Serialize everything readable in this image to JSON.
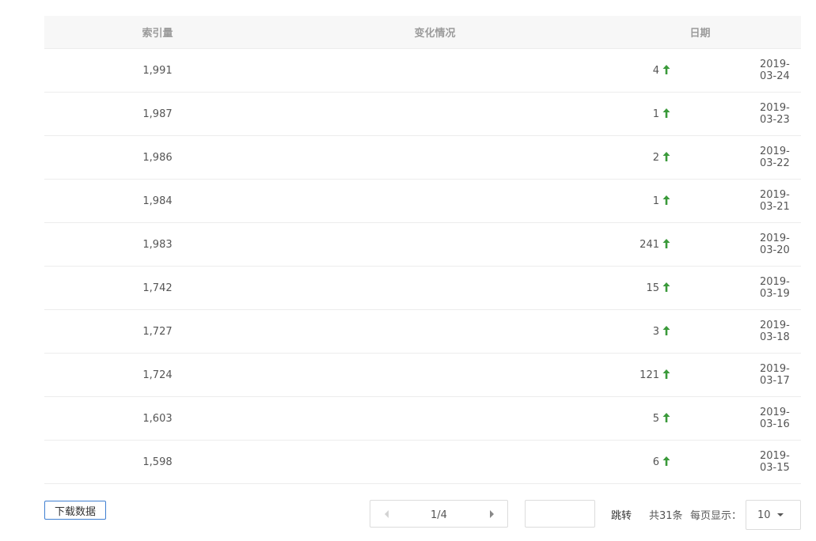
{
  "table": {
    "headers": [
      "索引量",
      "变化情况",
      "日期"
    ],
    "rows": [
      {
        "index": "1,991",
        "change": "4",
        "date": "2019-03-24"
      },
      {
        "index": "1,987",
        "change": "1",
        "date": "2019-03-23"
      },
      {
        "index": "1,986",
        "change": "2",
        "date": "2019-03-22"
      },
      {
        "index": "1,984",
        "change": "1",
        "date": "2019-03-21"
      },
      {
        "index": "1,983",
        "change": "241",
        "date": "2019-03-20"
      },
      {
        "index": "1,742",
        "change": "15",
        "date": "2019-03-19"
      },
      {
        "index": "1,727",
        "change": "3",
        "date": "2019-03-18"
      },
      {
        "index": "1,724",
        "change": "121",
        "date": "2019-03-17"
      },
      {
        "index": "1,603",
        "change": "5",
        "date": "2019-03-16"
      },
      {
        "index": "1,598",
        "change": "6",
        "date": "2019-03-15"
      }
    ],
    "change_icon": "arrow-up-icon",
    "up_color": "#3a9a3a"
  },
  "footer": {
    "download_label": "下载数据",
    "pager_text": "1/4",
    "jump_value": "",
    "jump_label": "跳转",
    "total_text": "共31条",
    "per_page_label": "每页显示：",
    "per_page_value": "10"
  }
}
